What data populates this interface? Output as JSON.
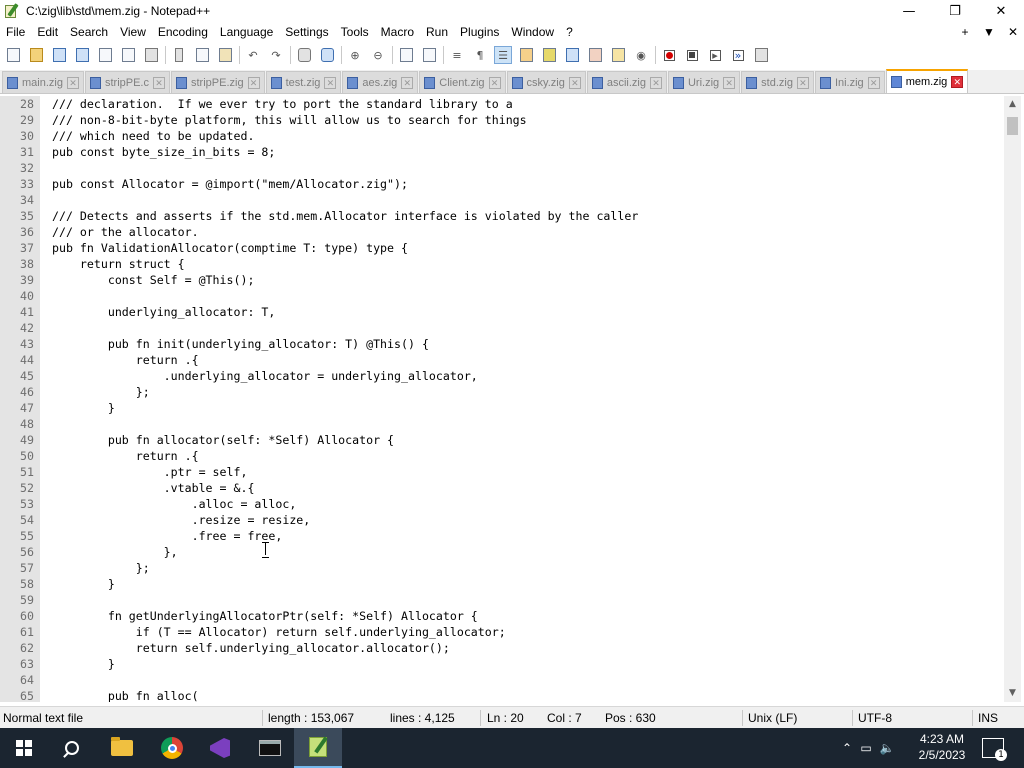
{
  "window": {
    "title": "C:\\zig\\lib\\std\\mem.zig - Notepad++",
    "minimize": "—",
    "maximize": "❐",
    "close": "✕"
  },
  "menu": {
    "items": [
      "File",
      "Edit",
      "Search",
      "View",
      "Encoding",
      "Language",
      "Settings",
      "Tools",
      "Macro",
      "Run",
      "Plugins",
      "Window",
      "?"
    ],
    "right": [
      "+",
      "▼",
      "✕"
    ]
  },
  "tabs": [
    {
      "label": "main.zig",
      "active": false
    },
    {
      "label": "stripPE.c",
      "active": false
    },
    {
      "label": "stripPE.zig",
      "active": false
    },
    {
      "label": "test.zig",
      "active": false
    },
    {
      "label": "aes.zig",
      "active": false
    },
    {
      "label": "Client.zig",
      "active": false
    },
    {
      "label": "csky.zig",
      "active": false
    },
    {
      "label": "ascii.zig",
      "active": false
    },
    {
      "label": "Uri.zig",
      "active": false
    },
    {
      "label": "std.zig",
      "active": false
    },
    {
      "label": "Ini.zig",
      "active": false
    },
    {
      "label": "mem.zig",
      "active": true
    }
  ],
  "editor": {
    "lines": [
      {
        "n": "28",
        "text": "/// declaration.  If we ever try to port the standard library to a"
      },
      {
        "n": "29",
        "text": "/// non-8-bit-byte platform, this will allow us to search for things"
      },
      {
        "n": "30",
        "text": "/// which need to be updated."
      },
      {
        "n": "31",
        "text": "pub const byte_size_in_bits = 8;"
      },
      {
        "n": "32",
        "text": ""
      },
      {
        "n": "33",
        "text": "pub const Allocator = @import(\"mem/Allocator.zig\");"
      },
      {
        "n": "34",
        "text": ""
      },
      {
        "n": "35",
        "text": "/// Detects and asserts if the std.mem.Allocator interface is violated by the caller"
      },
      {
        "n": "36",
        "text": "/// or the allocator."
      },
      {
        "n": "37",
        "text": "pub fn ValidationAllocator(comptime T: type) type {"
      },
      {
        "n": "38",
        "text": "    return struct {"
      },
      {
        "n": "39",
        "text": "        const Self = @This();"
      },
      {
        "n": "40",
        "text": ""
      },
      {
        "n": "41",
        "text": "        underlying_allocator: T,"
      },
      {
        "n": "42",
        "text": ""
      },
      {
        "n": "43",
        "text": "        pub fn init(underlying_allocator: T) @This() {"
      },
      {
        "n": "44",
        "text": "            return .{"
      },
      {
        "n": "45",
        "text": "                .underlying_allocator = underlying_allocator,"
      },
      {
        "n": "46",
        "text": "            };"
      },
      {
        "n": "47",
        "text": "        }"
      },
      {
        "n": "48",
        "text": ""
      },
      {
        "n": "49",
        "text": "        pub fn allocator(self: *Self) Allocator {"
      },
      {
        "n": "50",
        "text": "            return .{"
      },
      {
        "n": "51",
        "text": "                .ptr = self,"
      },
      {
        "n": "52",
        "text": "                .vtable = &.{"
      },
      {
        "n": "53",
        "text": "                    .alloc = alloc,"
      },
      {
        "n": "54",
        "text": "                    .resize = resize,"
      },
      {
        "n": "55",
        "text": "                    .free = free,"
      },
      {
        "n": "56",
        "text": "                },"
      },
      {
        "n": "57",
        "text": "            };"
      },
      {
        "n": "58",
        "text": "        }"
      },
      {
        "n": "59",
        "text": ""
      },
      {
        "n": "60",
        "text": "        fn getUnderlyingAllocatorPtr(self: *Self) Allocator {"
      },
      {
        "n": "61",
        "text": "            if (T == Allocator) return self.underlying_allocator;"
      },
      {
        "n": "62",
        "text": "            return self.underlying_allocator.allocator();"
      },
      {
        "n": "63",
        "text": "        }"
      },
      {
        "n": "64",
        "text": ""
      },
      {
        "n": "65",
        "text": "        pub fn alloc("
      }
    ]
  },
  "statusbar": {
    "file_type": "Normal text file",
    "length": "length : 153,067",
    "lines": "lines : 4,125",
    "ln": "Ln : 20",
    "col": "Col : 7",
    "pos": "Pos : 630",
    "eol": "Unix (LF)",
    "encoding": "UTF-8",
    "mode": "INS"
  },
  "taskbar": {
    "time": "4:23 AM",
    "date": "2/5/2023",
    "notifications": "1"
  }
}
